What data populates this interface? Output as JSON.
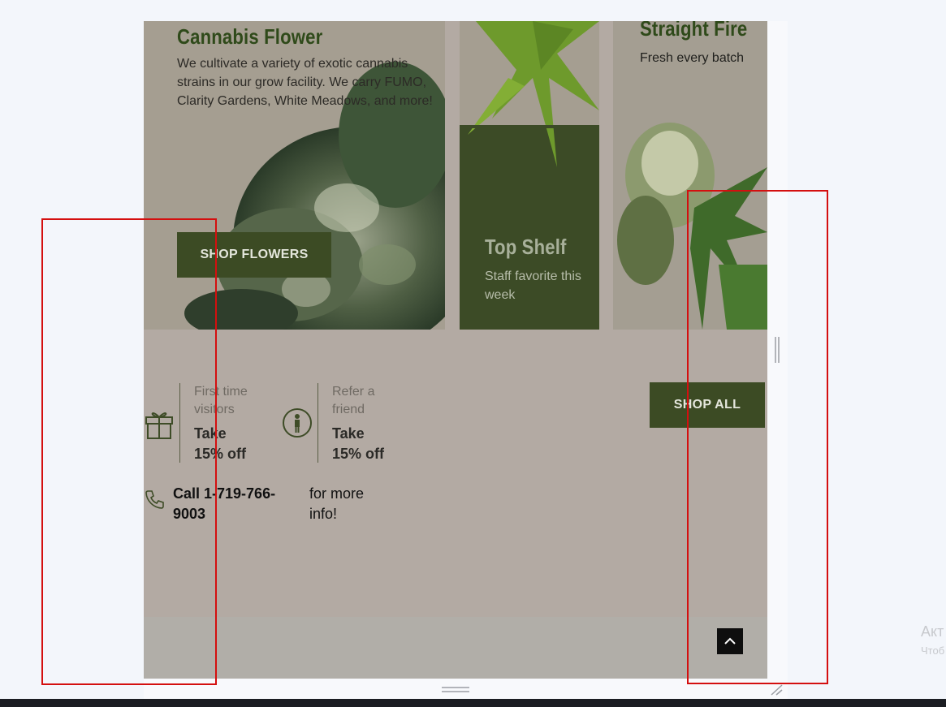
{
  "cards": {
    "flower": {
      "title": "Cannabis Flower",
      "text": "We cultivate a variety of exotic cannabis strains in our grow facility. We carry FUMO, Clarity Gardens, White Meadows, and more!",
      "button": "SHOP FLOWERS"
    },
    "top_shelf": {
      "title": "Top Shelf",
      "text": "Staff favorite this week"
    },
    "straight_fire": {
      "title": "Straight Fire",
      "text": "Fresh every batch"
    }
  },
  "promos": [
    {
      "icon": "gift-icon",
      "small": "First time visitors",
      "big": "Take 15% off"
    },
    {
      "icon": "person-icon",
      "small": "Refer a friend",
      "big": "Take 15% off"
    }
  ],
  "contact": {
    "phone": "Call 1-719-766-9003",
    "more": "for more info!"
  },
  "shop_all": "SHOP ALL",
  "os": {
    "activate_title": "Акт",
    "activate_sub": "Чтоб"
  },
  "colors": {
    "brand_green": "#3c4b24",
    "page_bg": "#b3aaa3",
    "annotation_red": "#d40f0f"
  }
}
